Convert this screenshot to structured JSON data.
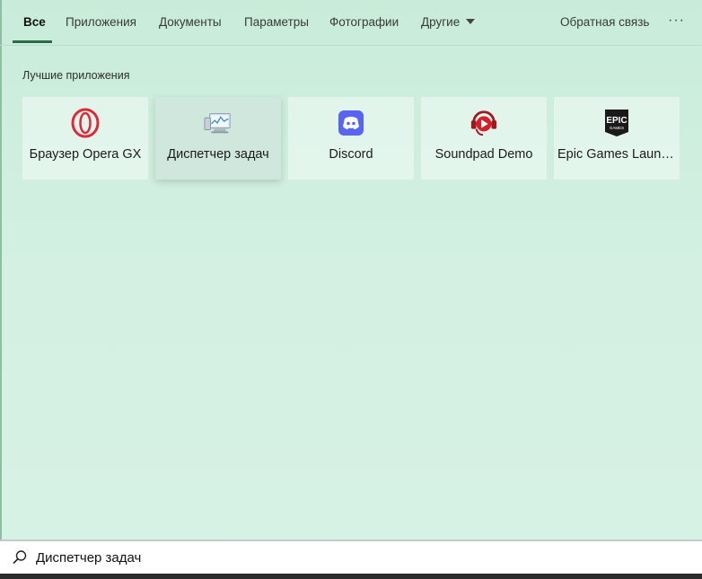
{
  "tabs": [
    {
      "label": "Все",
      "active": true
    },
    {
      "label": "Приложения"
    },
    {
      "label": "Документы"
    },
    {
      "label": "Параметры"
    },
    {
      "label": "Фотографии"
    },
    {
      "label": "Другие"
    }
  ],
  "header": {
    "feedback_label": "Обратная связь",
    "more_label": "···"
  },
  "best_apps": {
    "title": "Лучшие приложения",
    "items": [
      {
        "label": "Браузер Opera GX",
        "icon": "opera-gx-icon"
      },
      {
        "label": "Диспетчер задач",
        "icon": "task-manager-icon",
        "selected": true
      },
      {
        "label": "Discord",
        "icon": "discord-icon"
      },
      {
        "label": "Soundpad Demo",
        "icon": "soundpad-icon"
      },
      {
        "label": "Epic Games Launcher",
        "icon": "epic-games-icon"
      }
    ]
  },
  "search": {
    "value": "Диспетчер задач",
    "icon": "search-icon"
  },
  "colors": {
    "accent": "#2a6a48",
    "opera": "#e0283a",
    "discord": "#5865f2",
    "soundpad": "#d3202a"
  }
}
